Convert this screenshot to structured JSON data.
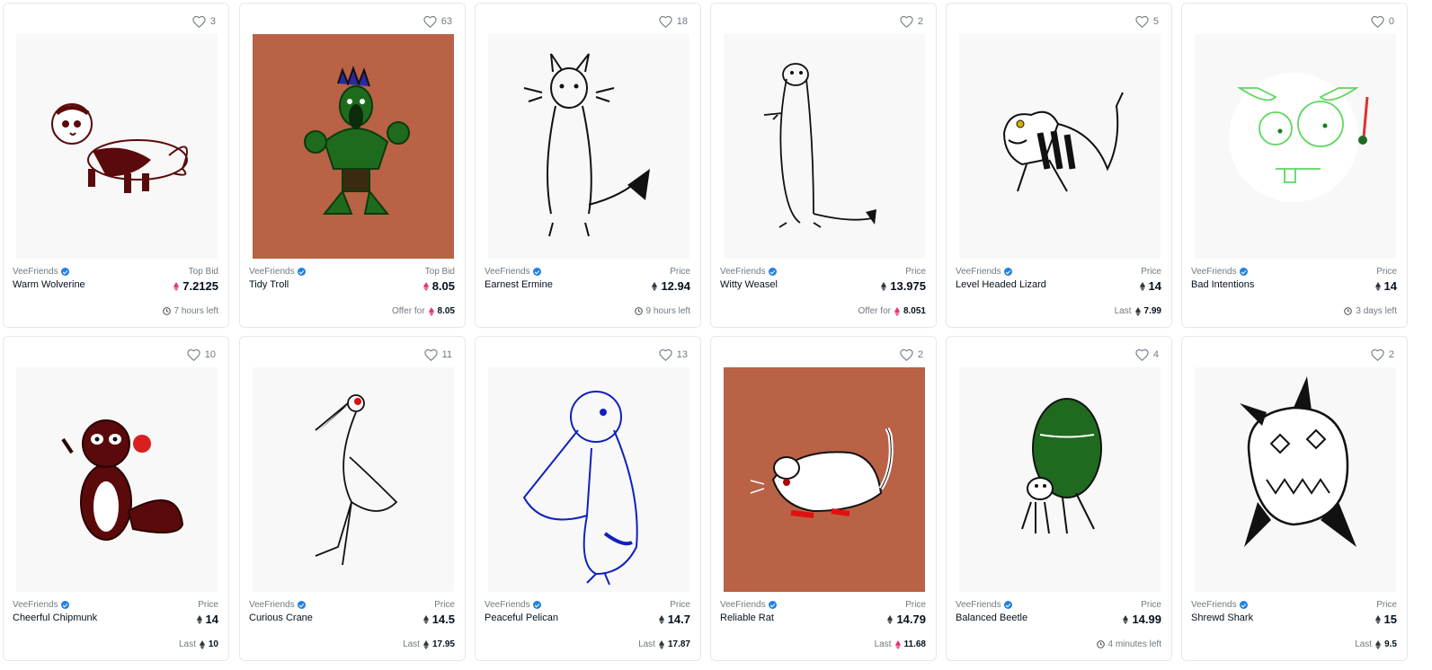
{
  "colors": {
    "weth": "#e6376f",
    "eth": "#353840",
    "art_brown": "#b96246",
    "verified": "#2081e2"
  },
  "cards": [
    {
      "likes": "3",
      "collection": "VeeFriends",
      "name": "Warm Wolverine",
      "price_label": "Top Bid",
      "price": "7.2125",
      "price_currency": "weth",
      "footer_type": "time",
      "footer_text": "7 hours left",
      "art_bg": "light",
      "art": "wolverine"
    },
    {
      "likes": "63",
      "collection": "VeeFriends",
      "name": "Tidy Troll",
      "price_label": "Top Bid",
      "price": "8.05",
      "price_currency": "weth",
      "footer_type": "offer",
      "footer_text": "Offer for",
      "footer_value": "8.05",
      "footer_currency": "weth",
      "art_bg": "brown",
      "art": "troll"
    },
    {
      "likes": "18",
      "collection": "VeeFriends",
      "name": "Earnest Ermine",
      "price_label": "Price",
      "price": "12.94",
      "price_currency": "eth",
      "footer_type": "time",
      "footer_text": "9 hours left",
      "art_bg": "light",
      "art": "ermine"
    },
    {
      "likes": "2",
      "collection": "VeeFriends",
      "name": "Witty Weasel",
      "price_label": "Price",
      "price": "13.975",
      "price_currency": "eth",
      "footer_type": "offer",
      "footer_text": "Offer for",
      "footer_value": "8.051",
      "footer_currency": "weth",
      "art_bg": "light",
      "art": "weasel"
    },
    {
      "likes": "5",
      "collection": "VeeFriends",
      "name": "Level Headed Lizard",
      "price_label": "Price",
      "price": "14",
      "price_currency": "eth",
      "footer_type": "last",
      "footer_text": "Last",
      "footer_value": "7.99",
      "footer_currency": "eth",
      "art_bg": "light",
      "art": "lizard"
    },
    {
      "likes": "0",
      "collection": "VeeFriends",
      "name": "Bad Intentions",
      "price_label": "Price",
      "price": "14",
      "price_currency": "eth",
      "footer_type": "time",
      "footer_text": "3 days left",
      "art_bg": "light",
      "art": "bunny"
    },
    {
      "likes": "10",
      "collection": "VeeFriends",
      "name": "Cheerful Chipmunk",
      "price_label": "Price",
      "price": "14",
      "price_currency": "eth",
      "footer_type": "last",
      "footer_text": "Last",
      "footer_value": "10",
      "footer_currency": "eth",
      "art_bg": "light",
      "art": "chipmunk"
    },
    {
      "likes": "11",
      "collection": "VeeFriends",
      "name": "Curious Crane",
      "price_label": "Price",
      "price": "14.5",
      "price_currency": "eth",
      "footer_type": "last",
      "footer_text": "Last",
      "footer_value": "17.95",
      "footer_currency": "eth",
      "art_bg": "light",
      "art": "crane"
    },
    {
      "likes": "13",
      "collection": "VeeFriends",
      "name": "Peaceful Pelican",
      "price_label": "Price",
      "price": "14.7",
      "price_currency": "eth",
      "footer_type": "last",
      "footer_text": "Last",
      "footer_value": "17.87",
      "footer_currency": "eth",
      "art_bg": "light",
      "art": "pelican"
    },
    {
      "likes": "2",
      "collection": "VeeFriends",
      "name": "Reliable Rat",
      "price_label": "Price",
      "price": "14.79",
      "price_currency": "eth",
      "footer_type": "last",
      "footer_text": "Last",
      "footer_value": "11.68",
      "footer_currency": "weth",
      "art_bg": "brown",
      "art": "rat"
    },
    {
      "likes": "4",
      "collection": "VeeFriends",
      "name": "Balanced Beetle",
      "price_label": "Price",
      "price": "14.99",
      "price_currency": "eth",
      "footer_type": "time",
      "footer_text": "4 minutes left",
      "art_bg": "light",
      "art": "beetle"
    },
    {
      "likes": "2",
      "collection": "VeeFriends",
      "name": "Shrewd Shark",
      "price_label": "Price",
      "price": "15",
      "price_currency": "eth",
      "footer_type": "last",
      "footer_text": "Last",
      "footer_value": "9.5",
      "footer_currency": "eth",
      "art_bg": "light",
      "art": "shark"
    }
  ]
}
